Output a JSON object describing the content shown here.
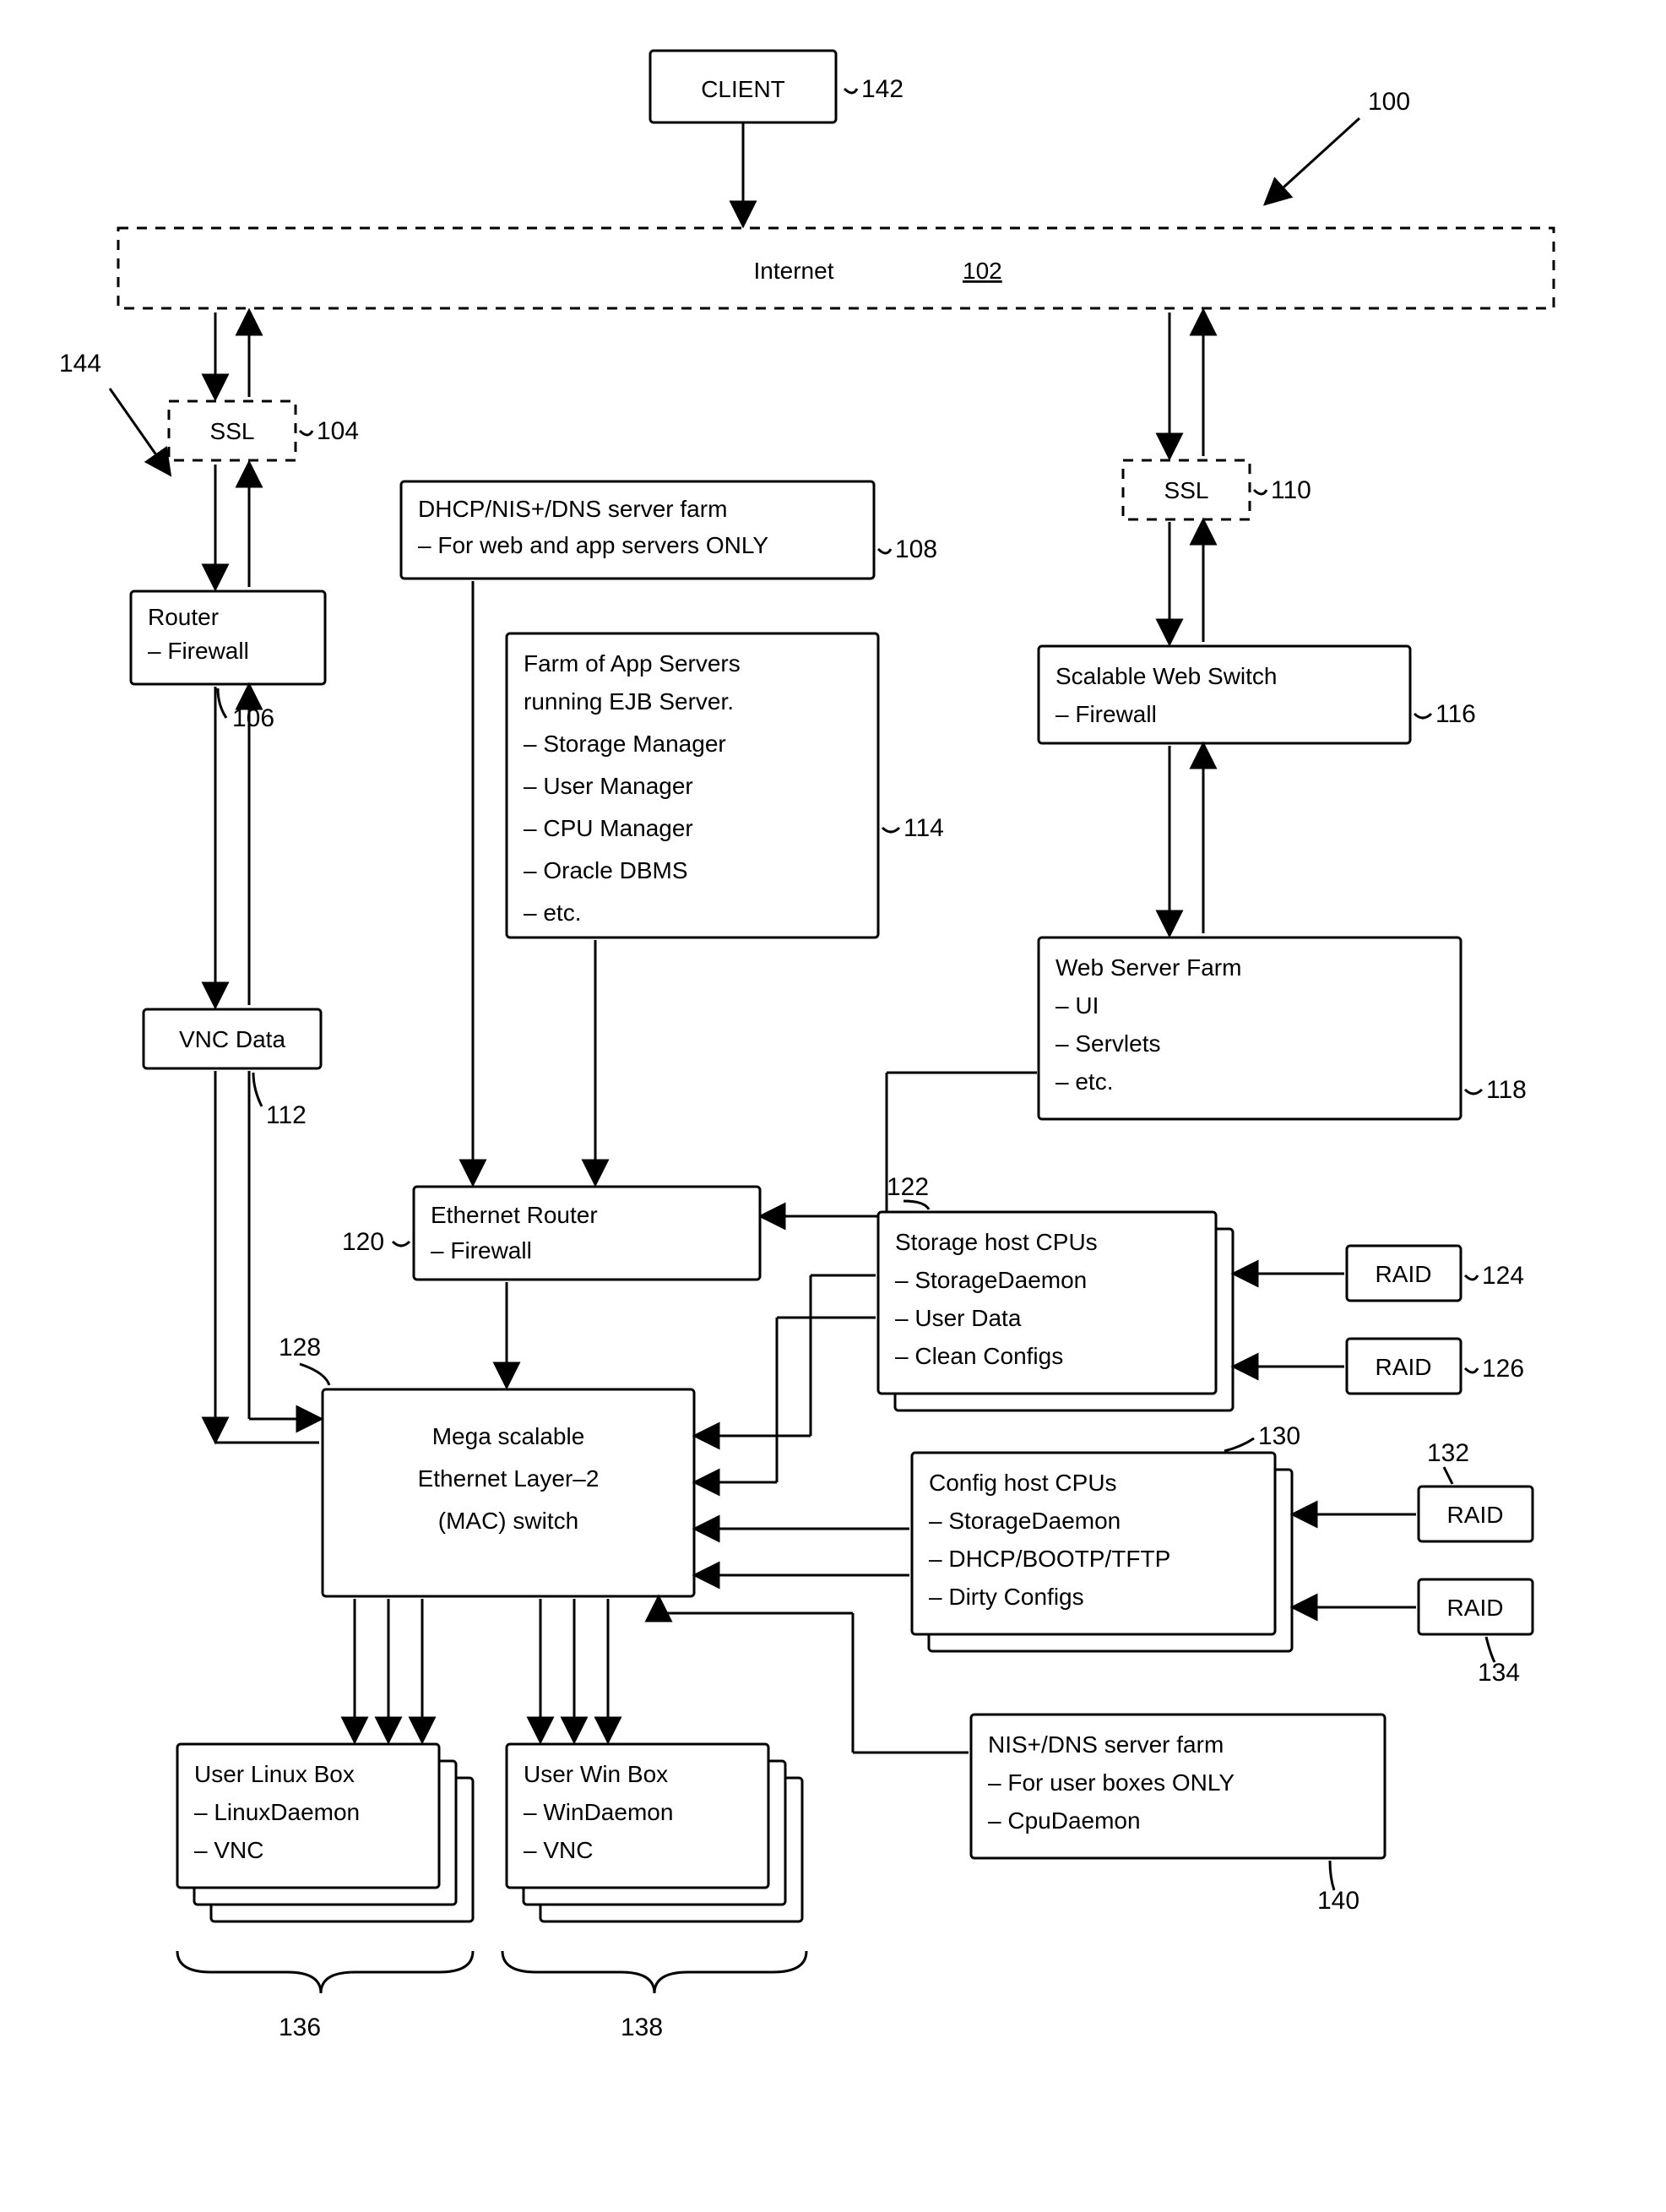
{
  "labels": {
    "n100": "100",
    "n102": "102",
    "n104": "104",
    "n106": "106",
    "n108": "108",
    "n110": "110",
    "n112": "112",
    "n114": "114",
    "n116": "116",
    "n118": "118",
    "n120": "120",
    "n122": "122",
    "n124": "124",
    "n126": "126",
    "n128": "128",
    "n130": "130",
    "n132": "132",
    "n134": "134",
    "n136": "136",
    "n138": "138",
    "n140": "140",
    "n142": "142",
    "n144": "144"
  },
  "client": {
    "title": "CLIENT"
  },
  "internet": {
    "title": "Internet"
  },
  "ssl_left": {
    "title": "SSL"
  },
  "ssl_right": {
    "title": "SSL"
  },
  "router": {
    "l1": "Router",
    "l2": "– Firewall"
  },
  "dhcp": {
    "l1": "DHCP/NIS+/DNS server farm",
    "l2": "– For web and app servers ONLY"
  },
  "appfarm": {
    "l1": "Farm of App Servers",
    "l2": "running EJB Server.",
    "l3": "– Storage Manager",
    "l4": "– User Manager",
    "l5": "– CPU Manager",
    "l6": "– Oracle DBMS",
    "l7": "– etc."
  },
  "webswitch": {
    "l1": "Scalable Web Switch",
    "l2": "– Firewall"
  },
  "webfarm": {
    "l1": "Web Server Farm",
    "l2": "– UI",
    "l3": "– Servlets",
    "l4": "– etc."
  },
  "vnc": {
    "l1": "VNC Data"
  },
  "ethrouter": {
    "l1": "Ethernet Router",
    "l2": "– Firewall"
  },
  "storage": {
    "l1": "Storage host CPUs",
    "l2": "– StorageDaemon",
    "l3": "– User Data",
    "l4": "– Clean Configs"
  },
  "raid": {
    "t": "RAID"
  },
  "mega": {
    "l1": "Mega scalable",
    "l2": "Ethernet Layer–2",
    "l3": "(MAC) switch"
  },
  "config": {
    "l1": "Config host CPUs",
    "l2": "– StorageDaemon",
    "l3": "– DHCP/BOOTP/TFTP",
    "l4": "– Dirty Configs"
  },
  "linux": {
    "l1": "User Linux Box",
    "l2": "– LinuxDaemon",
    "l3": "– VNC"
  },
  "win": {
    "l1": "User Win Box",
    "l2": "– WinDaemon",
    "l3": "– VNC"
  },
  "nis": {
    "l1": "NIS+/DNS server farm",
    "l2": "– For user boxes ONLY",
    "l3": "– CpuDaemon"
  }
}
